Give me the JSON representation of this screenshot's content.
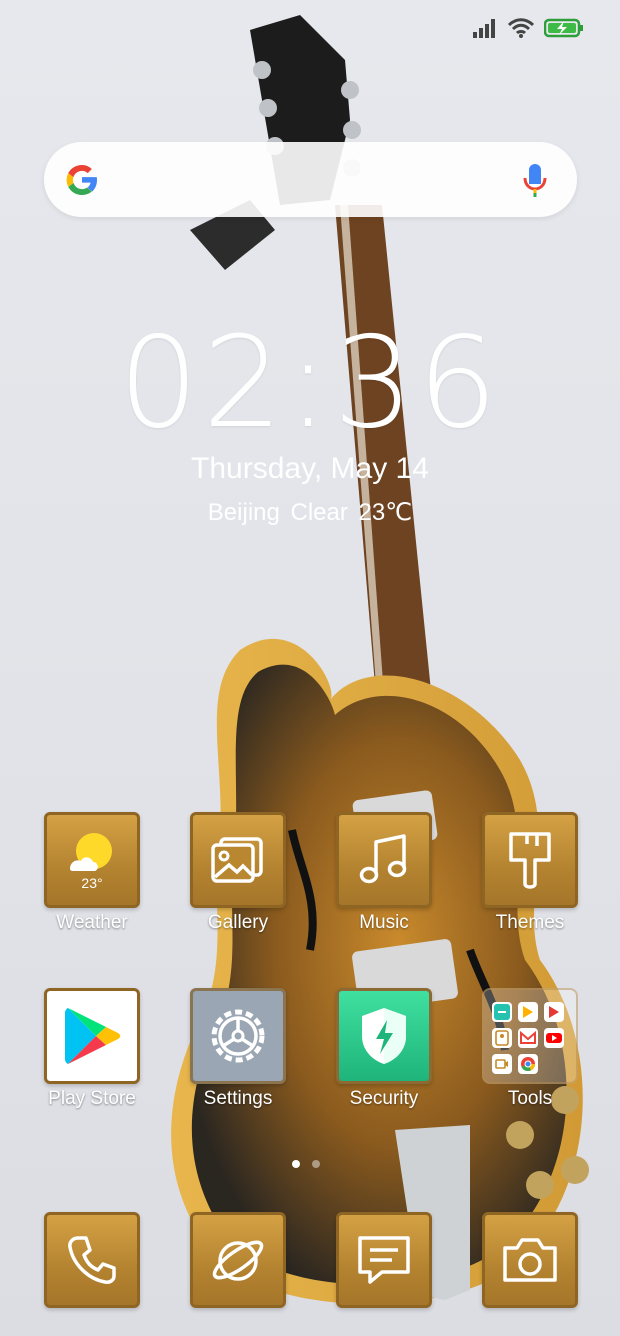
{
  "clock": {
    "time": "02:36",
    "date": "Thursday, May 14",
    "weather": "Beijing  Clear  23℃"
  },
  "apps_row1": [
    {
      "label": "Weather",
      "icon": "weather-icon",
      "sub": "23°"
    },
    {
      "label": "Gallery",
      "icon": "gallery-icon"
    },
    {
      "label": "Music",
      "icon": "music-icon"
    },
    {
      "label": "Themes",
      "icon": "themes-icon"
    }
  ],
  "apps_row2": [
    {
      "label": "Play Store",
      "icon": "play-store-icon"
    },
    {
      "label": "Settings",
      "icon": "settings-icon"
    },
    {
      "label": "Security",
      "icon": "security-icon"
    },
    {
      "label": "Tools",
      "icon": "tools-folder-icon"
    }
  ],
  "dock": [
    {
      "icon": "phone-icon"
    },
    {
      "icon": "browser-icon"
    },
    {
      "icon": "messages-icon"
    },
    {
      "icon": "camera-icon"
    }
  ],
  "colors": {
    "tile_gold": "#c08f3a",
    "security_green": "#2fcf8f",
    "settings_gray": "#9aa6b3"
  }
}
